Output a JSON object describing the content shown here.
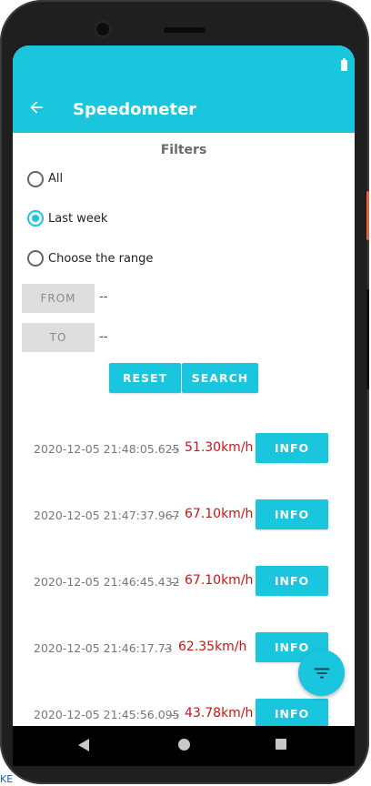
{
  "app": {
    "title": "Speedometer"
  },
  "filters": {
    "heading": "Filters",
    "options": [
      {
        "label": "All",
        "checked": false
      },
      {
        "label": "Last week",
        "checked": true
      },
      {
        "label": "Choose the range",
        "checked": false
      }
    ],
    "from_label": "FROM",
    "from_value": "--",
    "to_label": "TO",
    "to_value": "--",
    "reset_label": "RESET",
    "search_label": "SEARCH"
  },
  "records": [
    {
      "timestamp": "2020-12-05 21:48:05.625",
      "separator": "--",
      "speed": "51.30km/h",
      "info_label": "INFO"
    },
    {
      "timestamp": "2020-12-05 21:47:37.967",
      "separator": "--",
      "speed": "67.10km/h",
      "info_label": "INFO"
    },
    {
      "timestamp": "2020-12-05 21:46:45.432",
      "separator": "--",
      "speed": "67.10km/h",
      "info_label": "INFO"
    },
    {
      "timestamp": "2020-12-05 21:46:17.73",
      "separator": "--",
      "speed": "62.35km/h",
      "info_label": "INFO"
    },
    {
      "timestamp": "2020-12-05 21:45:56.095",
      "separator": "--",
      "speed": "43.78km/h",
      "info_label": "INFO"
    }
  ],
  "edge_text": "KE",
  "icons": {
    "back": "arrow-left-icon",
    "fab": "filter-list-icon",
    "battery": "battery-icon",
    "nav_back": "triangle-back-icon",
    "nav_home": "circle-home-icon",
    "nav_recent": "square-recent-icon"
  },
  "colors": {
    "primary": "#1ac5de",
    "speed": "#cc1414"
  }
}
